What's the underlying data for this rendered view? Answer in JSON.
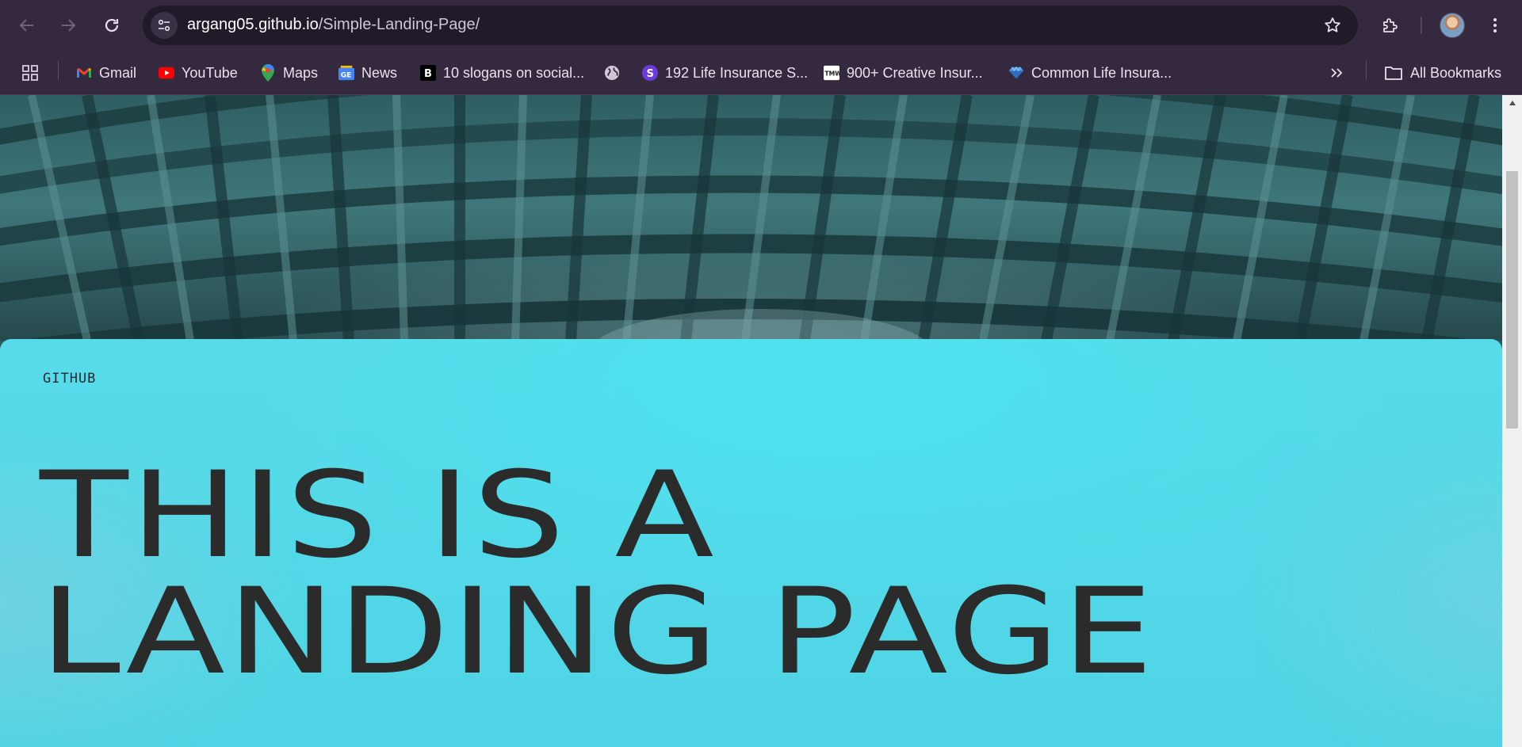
{
  "browser": {
    "url_host": "argang05.github.io",
    "url_path": "/Simple-Landing-Page/"
  },
  "bookmarks": {
    "items": [
      {
        "label": "Gmail",
        "icon": "gmail-icon"
      },
      {
        "label": "YouTube",
        "icon": "youtube-icon"
      },
      {
        "label": "Maps",
        "icon": "maps-icon"
      },
      {
        "label": "News",
        "icon": "google-news-icon"
      },
      {
        "label": "10 slogans on social...",
        "icon": "b-logo-icon"
      },
      {
        "label": "",
        "icon": "globe-icon"
      },
      {
        "label": "192 Life Insurance S...",
        "icon": "s-logo-icon"
      },
      {
        "label": "900+ Creative Insur...",
        "icon": "tmw-logo-icon"
      },
      {
        "label": "Common Life Insura...",
        "icon": "gem-icon"
      }
    ],
    "all_bookmarks_label": "All Bookmarks"
  },
  "page": {
    "nav_link": "GITHUB",
    "headline_line1": "THIS IS A",
    "headline_line2": "LANDING PAGE"
  },
  "colors": {
    "chrome_bg": "#35293f",
    "omnibox_bg": "#211a29",
    "card_bg": "#52d8e8",
    "headline_text": "#2b2b2b"
  }
}
